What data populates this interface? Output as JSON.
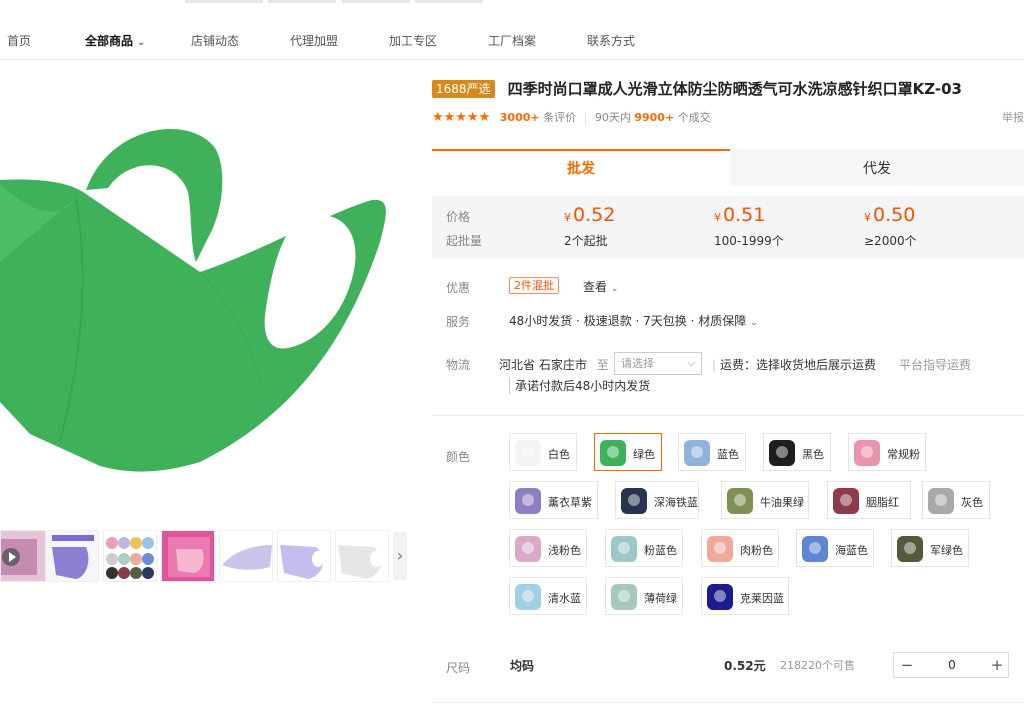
{
  "nav": {
    "items": [
      {
        "label": "首页"
      },
      {
        "label": "全部商品"
      },
      {
        "label": "店铺动态"
      },
      {
        "label": "代理加盟"
      },
      {
        "label": "加工专区"
      },
      {
        "label": "工厂档案"
      },
      {
        "label": "联系方式"
      }
    ]
  },
  "product": {
    "badge": "1688严选",
    "title": "四季时尚口罩成人光滑立体防尘防晒透气可水洗凉感针织口罩KZ-03",
    "stars": "★★★★★",
    "reviews_count": "3000+",
    "reviews_label": "条评价",
    "sales_prefix": "90天内",
    "sales_count": "9900+",
    "sales_suffix": "个成交",
    "report": "举报",
    "main_color": "#3fb15a"
  },
  "tabs": {
    "wholesale": "批发",
    "dropship": "代发"
  },
  "pricing": {
    "price_label": "价格",
    "moq_label": "起批量",
    "currency": "¥",
    "tiers": [
      {
        "price": "0.52",
        "qty": "2个起批"
      },
      {
        "price": "0.51",
        "qty": "100-1999个"
      },
      {
        "price": "0.50",
        "qty": "≥2000个"
      }
    ]
  },
  "promo": {
    "label": "优惠",
    "badge": "2件混批",
    "lookup": "查看"
  },
  "service": {
    "label": "服务",
    "text": "48小时发货 · 极速退款 · 7天包换 · 材质保障"
  },
  "logistics": {
    "label": "物流",
    "origin": "河北省 石家庄市",
    "to": "至",
    "placeholder": "请选择",
    "fee": "运费：选择收货地后展示运费",
    "guide": "平台指导运费",
    "ship_promise": "承诺付款后48小时内发货"
  },
  "colors": {
    "label": "颜色",
    "options": [
      {
        "name": "白色",
        "hex": "#f4f4f4"
      },
      {
        "name": "绿色",
        "hex": "#3fb15a"
      },
      {
        "name": "蓝色",
        "hex": "#8fb2dc"
      },
      {
        "name": "黑色",
        "hex": "#1e1e1e"
      },
      {
        "name": "常规粉",
        "hex": "#ea93ac"
      },
      {
        "name": "薰衣草紫",
        "hex": "#8e7fc2"
      },
      {
        "name": "深海铁蓝",
        "hex": "#27334f"
      },
      {
        "name": "牛油果绿",
        "hex": "#7f8f55"
      },
      {
        "name": "胭脂红",
        "hex": "#8d3c4c"
      },
      {
        "name": "灰色",
        "hex": "#a9a9ab"
      },
      {
        "name": "浅粉色",
        "hex": "#d8a9c8"
      },
      {
        "name": "粉蓝色",
        "hex": "#9cc6c8"
      },
      {
        "name": "肉粉色",
        "hex": "#efa99b"
      },
      {
        "name": "海蓝色",
        "hex": "#5e86d4"
      },
      {
        "name": "军绿色",
        "hex": "#56583c"
      },
      {
        "name": "清水蓝",
        "hex": "#9fd0e6"
      },
      {
        "name": "薄荷绿",
        "hex": "#a5c9bb"
      },
      {
        "name": "克莱因蓝",
        "hex": "#1d1c8e"
      }
    ]
  },
  "size": {
    "label": "尺码",
    "name": "均码",
    "price": "0.52元",
    "stock": "218220个可售",
    "quantity": "0",
    "minus": "−",
    "plus": "+"
  }
}
